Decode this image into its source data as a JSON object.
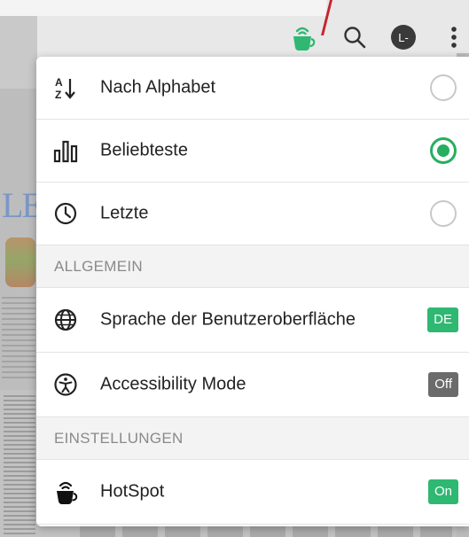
{
  "colors": {
    "accent_green": "#27ae60",
    "badge_green": "#2eb872",
    "badge_grey": "#6b6b6b"
  },
  "topbar": {
    "hotspot_icon": "hotspot-cup-icon",
    "search_icon": "search-icon",
    "avatar_initial": "L-",
    "more_icon": "more-vertical-icon"
  },
  "menu": {
    "sort_options": [
      {
        "label": "Nach Alphabet",
        "icon": "sort-alpha-icon",
        "selected": false
      },
      {
        "label": "Beliebteste",
        "icon": "bar-chart-icon",
        "selected": true
      },
      {
        "label": "Letzte",
        "icon": "clock-icon",
        "selected": false
      }
    ],
    "section_general": "ALLGEMEIN",
    "language": {
      "label": "Sprache der Benutzeroberfläche",
      "value": "DE",
      "icon": "globe-icon"
    },
    "accessibility": {
      "label": "Accessibility Mode",
      "value": "Off",
      "icon": "accessibility-icon"
    },
    "section_settings": "EINSTELLUNGEN",
    "hotspot": {
      "label": "HotSpot",
      "value": "On",
      "icon": "hotspot-cup-icon"
    }
  }
}
